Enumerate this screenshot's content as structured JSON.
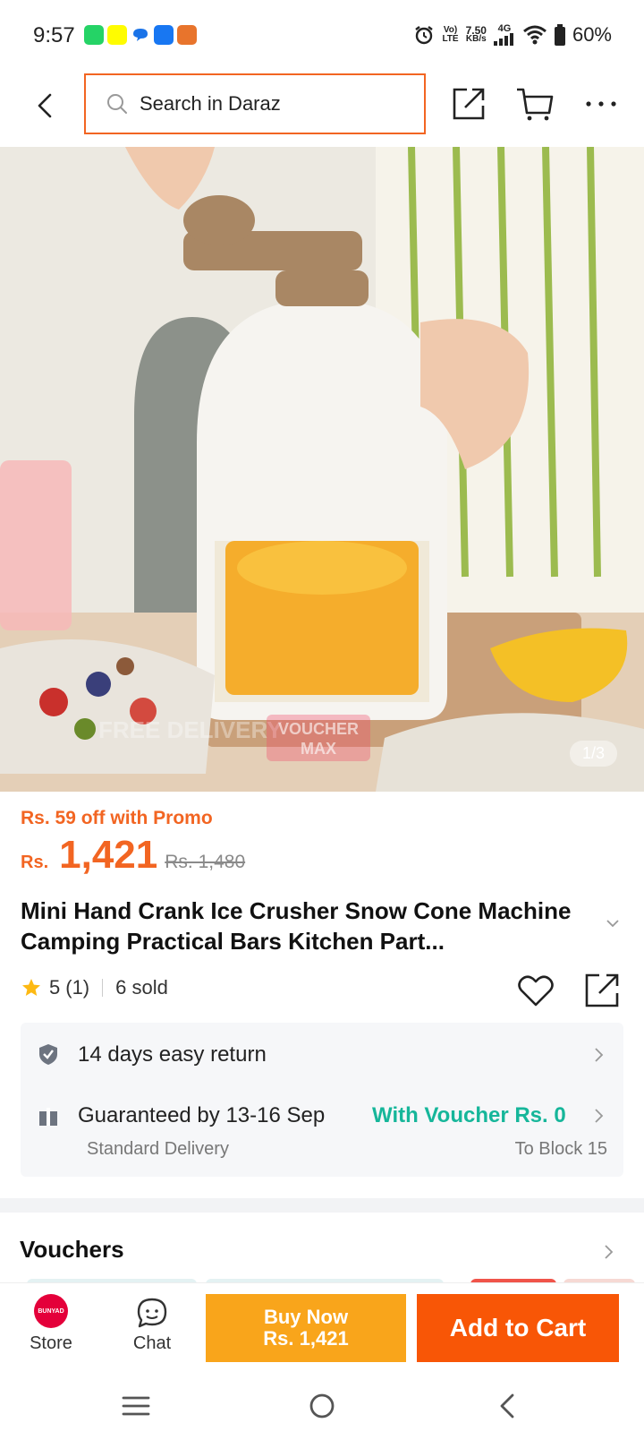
{
  "status_bar": {
    "time": "9:57",
    "volte_line1": "Vo)",
    "volte_line2": "LTE",
    "speed_value": "7.50",
    "speed_unit": "KB/s",
    "network": "4G",
    "battery": "60%",
    "notification_icons": [
      "whatsapp-icon",
      "snapchat-icon",
      "messenger-icon",
      "facebook-icon",
      "game-icon"
    ]
  },
  "top_nav": {
    "search_placeholder": "Search in Daraz",
    "accent_color": "#f26522"
  },
  "gallery": {
    "counter": "1/3",
    "watermark_left": "FREE DELIVERY",
    "watermark_right_1": "VOUCHER",
    "watermark_right_2": "MAX"
  },
  "product": {
    "promo": "Rs. 59 off with Promo",
    "currency": "Rs.",
    "price": "1,421",
    "original_price": "Rs. 1,480",
    "title": "Mini Hand Crank Ice Crusher Snow Cone Machine Camping Practical Bars Kitchen Part...",
    "rating": "5",
    "rating_count": "(1)",
    "sold": "6 sold",
    "rating_value": 5
  },
  "services": {
    "return_text": "14 days easy return",
    "delivery_text": "Guaranteed by 13-16 Sep",
    "voucher_text": "With Voucher Rs. 0",
    "delivery_type": "Standard Delivery",
    "delivery_location": "To Block 15",
    "voucher_color": "#16b69a"
  },
  "vouchers": {
    "title": "Vouchers"
  },
  "bottom_bar": {
    "store_logo_text": "BUNYAD",
    "store_label": "Store",
    "chat_label": "Chat",
    "buy_now_line1": "Buy Now",
    "buy_now_line2": "Rs. 1,421",
    "add_to_cart": "Add to Cart",
    "buy_color": "#f9a51b",
    "cart_color": "#f85606"
  }
}
